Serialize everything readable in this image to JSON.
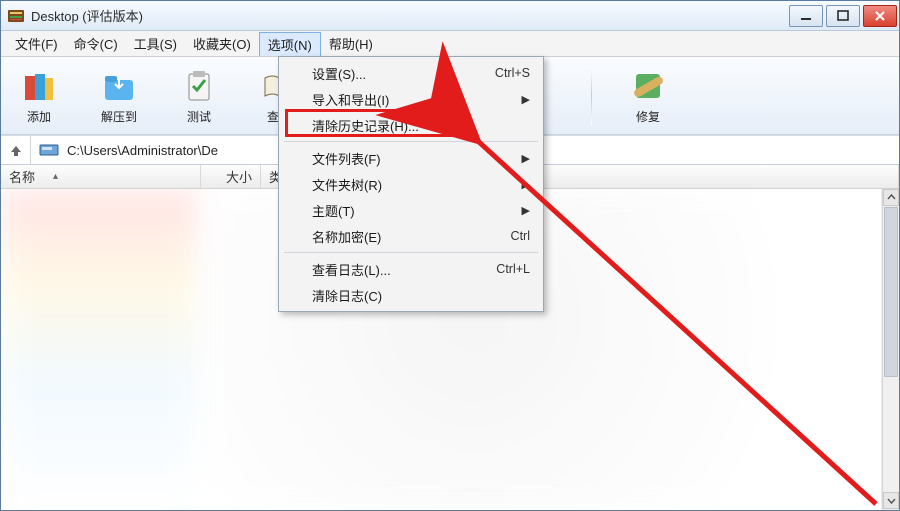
{
  "window": {
    "title": "Desktop (评估版本)"
  },
  "menubar": {
    "items": [
      {
        "label": "文件(F)"
      },
      {
        "label": "命令(C)"
      },
      {
        "label": "工具(S)"
      },
      {
        "label": "收藏夹(O)"
      },
      {
        "label": "选项(N)"
      },
      {
        "label": "帮助(H)"
      }
    ]
  },
  "toolbar": {
    "items": [
      {
        "label": "添加"
      },
      {
        "label": "解压到"
      },
      {
        "label": "测试"
      },
      {
        "label": "查看"
      },
      {
        "label": "修复"
      }
    ]
  },
  "path": {
    "value": "C:\\Users\\Administrator\\De"
  },
  "columns": {
    "name": "名称",
    "size": "大小",
    "type": "类"
  },
  "dropdown": {
    "items": [
      {
        "label": "设置(S)...",
        "shortcut": "Ctrl+S",
        "sub": false
      },
      {
        "label": "导入和导出(I)",
        "shortcut": "",
        "sub": true
      },
      {
        "label": "清除历史记录(H)...",
        "shortcut": "",
        "sub": false,
        "highlighted": true
      },
      {
        "sep": true
      },
      {
        "label": "文件列表(F)",
        "shortcut": "",
        "sub": true
      },
      {
        "label": "文件夹树(R)",
        "shortcut": "",
        "sub": true
      },
      {
        "label": "主题(T)",
        "shortcut": "",
        "sub": true
      },
      {
        "label": "名称加密(E)",
        "shortcut": "Ctrl",
        "sub": false
      },
      {
        "sep": true
      },
      {
        "label": "查看日志(L)...",
        "shortcut": "Ctrl+L",
        "sub": false
      },
      {
        "label": "清除日志(C)",
        "shortcut": "",
        "sub": false
      }
    ]
  }
}
